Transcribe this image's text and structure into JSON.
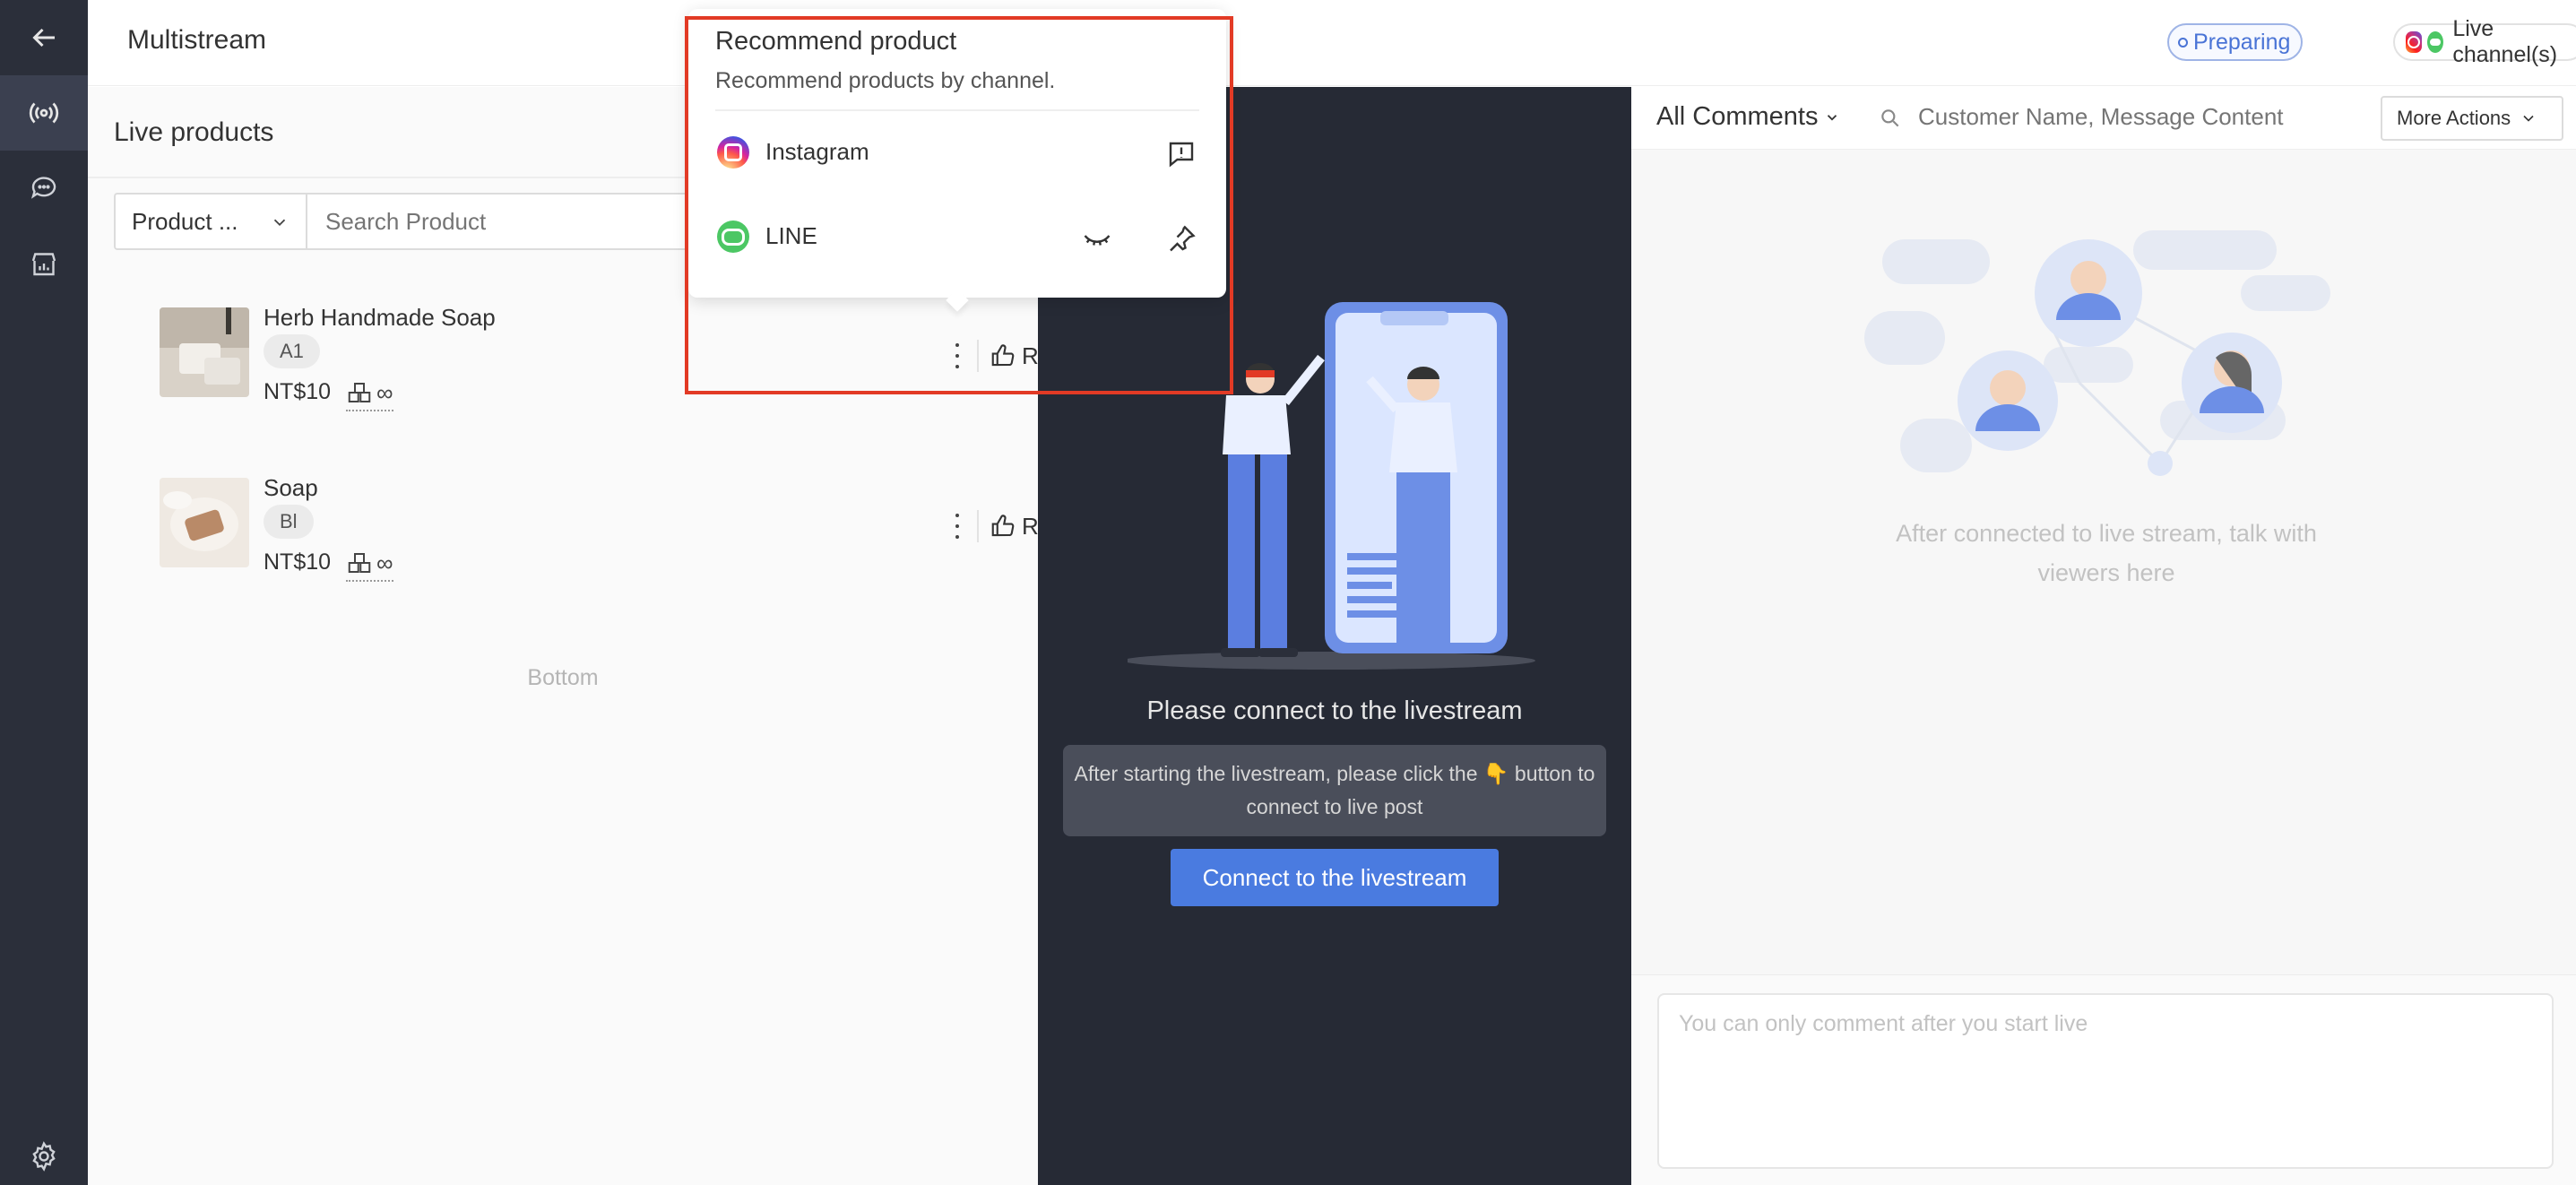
{
  "header": {
    "title": "Multistream",
    "status": "Preparing",
    "channels_label": "Live channel(s)"
  },
  "rail": {
    "icons": [
      "back-arrow-icon",
      "broadcast-icon",
      "chat-bubble-icon",
      "store-chart-icon",
      "gear-icon"
    ]
  },
  "products": {
    "title": "Live products",
    "filter": {
      "selected": "Product ..."
    },
    "search": {
      "placeholder": "Search Product"
    },
    "items": [
      {
        "name": "Herb Handmade Soap",
        "sku": "A1",
        "price": "NT$10",
        "stock": "∞",
        "rec_label": "Rec."
      },
      {
        "name": "Soap",
        "sku": "Bl",
        "price": "NT$10",
        "stock": "∞",
        "rec_label": "Rec."
      }
    ],
    "bottom_label": "Bottom"
  },
  "stream": {
    "title": "Please connect to the livestream",
    "hint": "After starting the livestream, please click the 👇 button to connect to live post",
    "connect_label": "Connect to the livestream"
  },
  "comments": {
    "filter_label": "All Comments",
    "search_placeholder": "Customer Name, Message Content",
    "more_actions_label": "More Actions",
    "empty_text": "After connected to live stream, talk with viewers here",
    "input_placeholder": "You can only comment after you start live"
  },
  "recommend_popover": {
    "title": "Recommend product",
    "subtitle": "Recommend products by channel.",
    "channels": [
      {
        "name": "Instagram",
        "icon": "instagram-icon",
        "actions": [
          "comment-alert-icon"
        ]
      },
      {
        "name": "LINE",
        "icon": "line-icon",
        "actions": [
          "hidden-eye-icon",
          "pin-icon"
        ]
      }
    ]
  },
  "colors": {
    "rail": "#2b2f3a",
    "accent": "#4a7be0",
    "stream_bg": "#262a35",
    "highlight": "#e23a25"
  }
}
